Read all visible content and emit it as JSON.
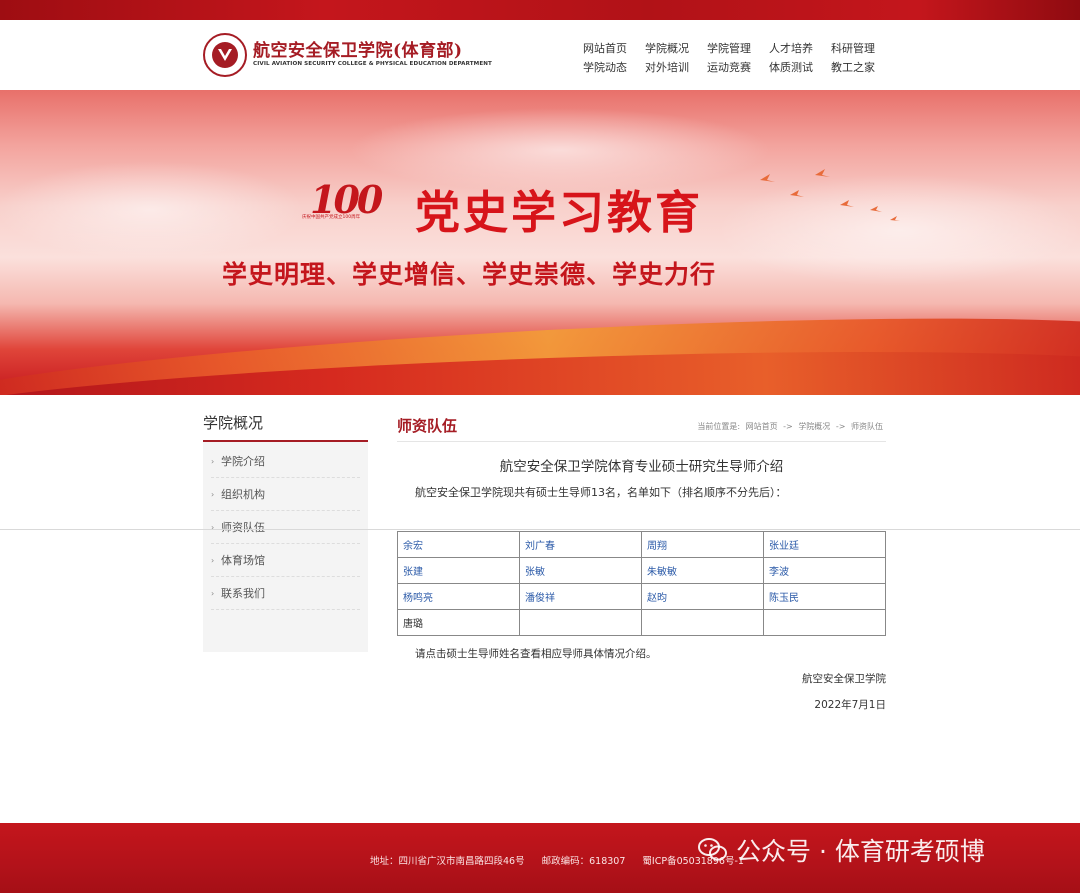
{
  "header": {
    "title": "航空安全保卫学院(体育部)",
    "subtitle": "CIVIL AVIATION SECURITY COLLEGE & PHYSICAL EDUCATION DEPARTMENT"
  },
  "nav": {
    "row1": [
      "网站首页",
      "学院概况",
      "学院管理",
      "人才培养",
      "科研管理"
    ],
    "row2": [
      "学院动态",
      "对外培训",
      "运动竞赛",
      "体质测试",
      "教工之家"
    ]
  },
  "banner": {
    "badge_number": "100",
    "badge_caption": "庆祝中国共产党成立100周年",
    "title": "党史学习教育",
    "slogan": "学史明理、学史增信、学史崇德、学史力行"
  },
  "sidebar": {
    "heading": "学院概况",
    "items": [
      "学院介绍",
      "组织机构",
      "师资队伍",
      "体育场馆",
      "联系我们"
    ]
  },
  "content": {
    "section_title": "师资队伍",
    "breadcrumb": [
      "当前位置是:",
      "网站首页",
      "->",
      "学院概况",
      "->",
      "师资队伍"
    ],
    "article_title": "航空安全保卫学院体育专业硕士研究生导师介绍",
    "intro": "航空安全保卫学院现共有硕士生导师13名，名单如下（排名顺序不分先后）：",
    "mentors": [
      [
        "余宏",
        "刘广春",
        "周翔",
        "张业廷"
      ],
      [
        "张建",
        "张敏",
        "朱敏敏",
        "李波"
      ],
      [
        "杨鸣亮",
        "潘俊祥",
        "赵昀",
        "陈玉民"
      ],
      [
        "唐璐",
        "",
        "",
        ""
      ]
    ],
    "note": "请点击硕士生导师姓名查看相应导师具体情况介绍。",
    "sign_org": "航空安全保卫学院",
    "sign_date": "2022年7月1日"
  },
  "footer": {
    "address": "地址：四川省广汉市南昌路四段46号",
    "postcode": "邮政编码：618307",
    "icp": "蜀ICP备05031896号-1"
  },
  "watermark": "公众号 · 体育研考硕博",
  "colors": {
    "brand_red": "#a51c24",
    "link_blue": "#2b5aa8",
    "footer_red": "#c4161c"
  }
}
